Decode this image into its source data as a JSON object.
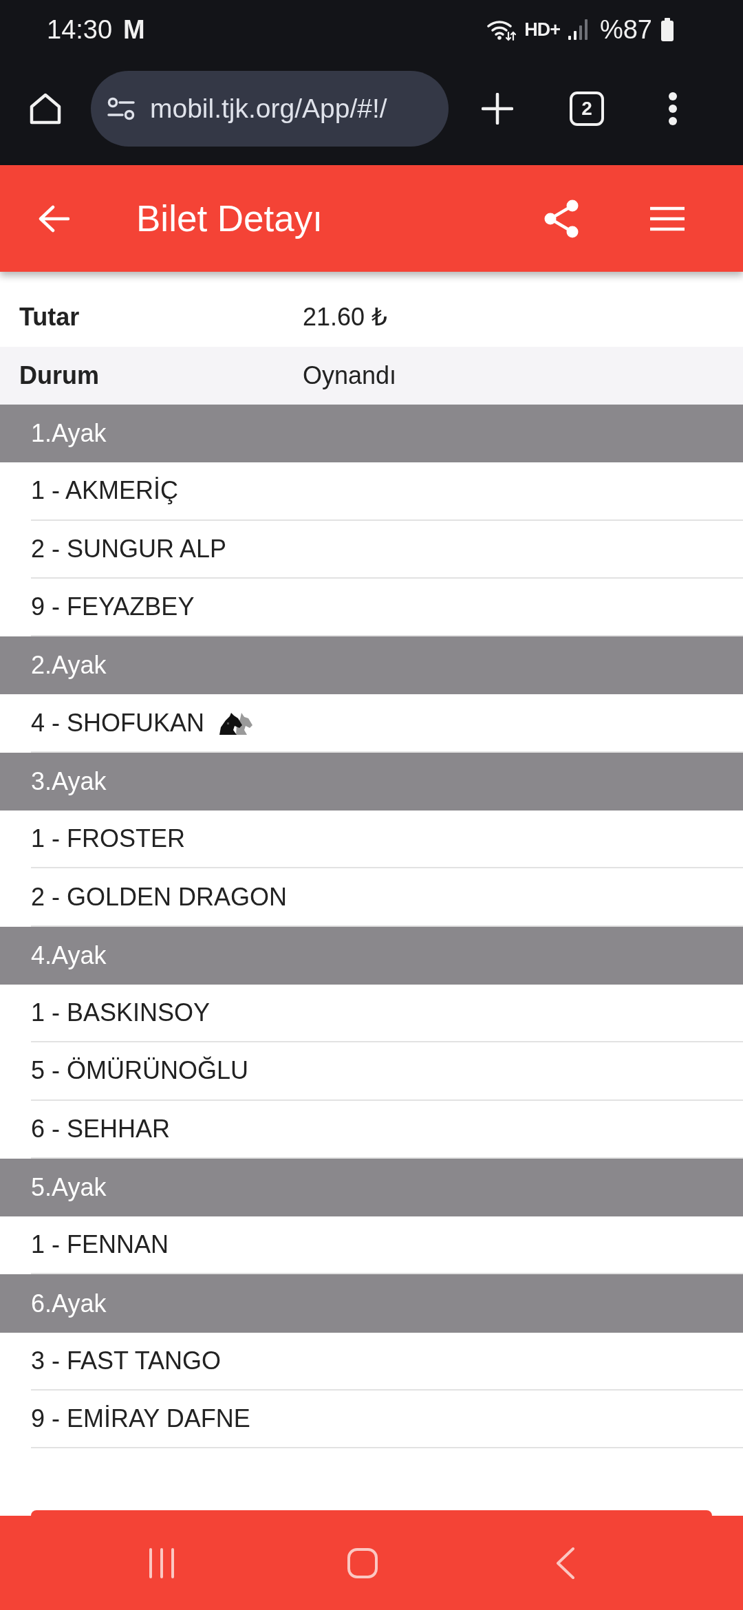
{
  "status_bar": {
    "time": "14:30",
    "notification": "M",
    "network": "HD+",
    "battery": "%87"
  },
  "browser": {
    "url": "mobil.tjk.org/App/#!/",
    "tab_count": "2"
  },
  "header": {
    "title": "Bilet Detayı"
  },
  "details": [
    {
      "label": "Tutar",
      "value": "21.60 ₺"
    },
    {
      "label": "Durum",
      "value": "Oynandı"
    }
  ],
  "legs": [
    {
      "title": "1.Ayak",
      "horses": [
        {
          "name": "1 - AKMERİÇ",
          "marked": false
        },
        {
          "name": "2 - SUNGUR ALP",
          "marked": false
        },
        {
          "name": "9 - FEYAZBEY",
          "marked": false
        }
      ]
    },
    {
      "title": "2.Ayak",
      "horses": [
        {
          "name": "4 - SHOFUKAN",
          "marked": true
        }
      ]
    },
    {
      "title": "3.Ayak",
      "horses": [
        {
          "name": "1 - FROSTER",
          "marked": false
        },
        {
          "name": "2 - GOLDEN DRAGON",
          "marked": false
        }
      ]
    },
    {
      "title": "4.Ayak",
      "horses": [
        {
          "name": "1 - BASKINSOY",
          "marked": false
        },
        {
          "name": "5 - ÖMÜRÜNOĞLU",
          "marked": false
        },
        {
          "name": "6 - SEHHAR",
          "marked": false
        }
      ]
    },
    {
      "title": "5.Ayak",
      "horses": [
        {
          "name": "1 - FENNAN",
          "marked": false
        }
      ]
    },
    {
      "title": "6.Ayak",
      "horses": [
        {
          "name": "3 - FAST TANGO",
          "marked": false
        },
        {
          "name": "9 - EMİRAY DAFNE",
          "marked": false
        }
      ]
    }
  ]
}
